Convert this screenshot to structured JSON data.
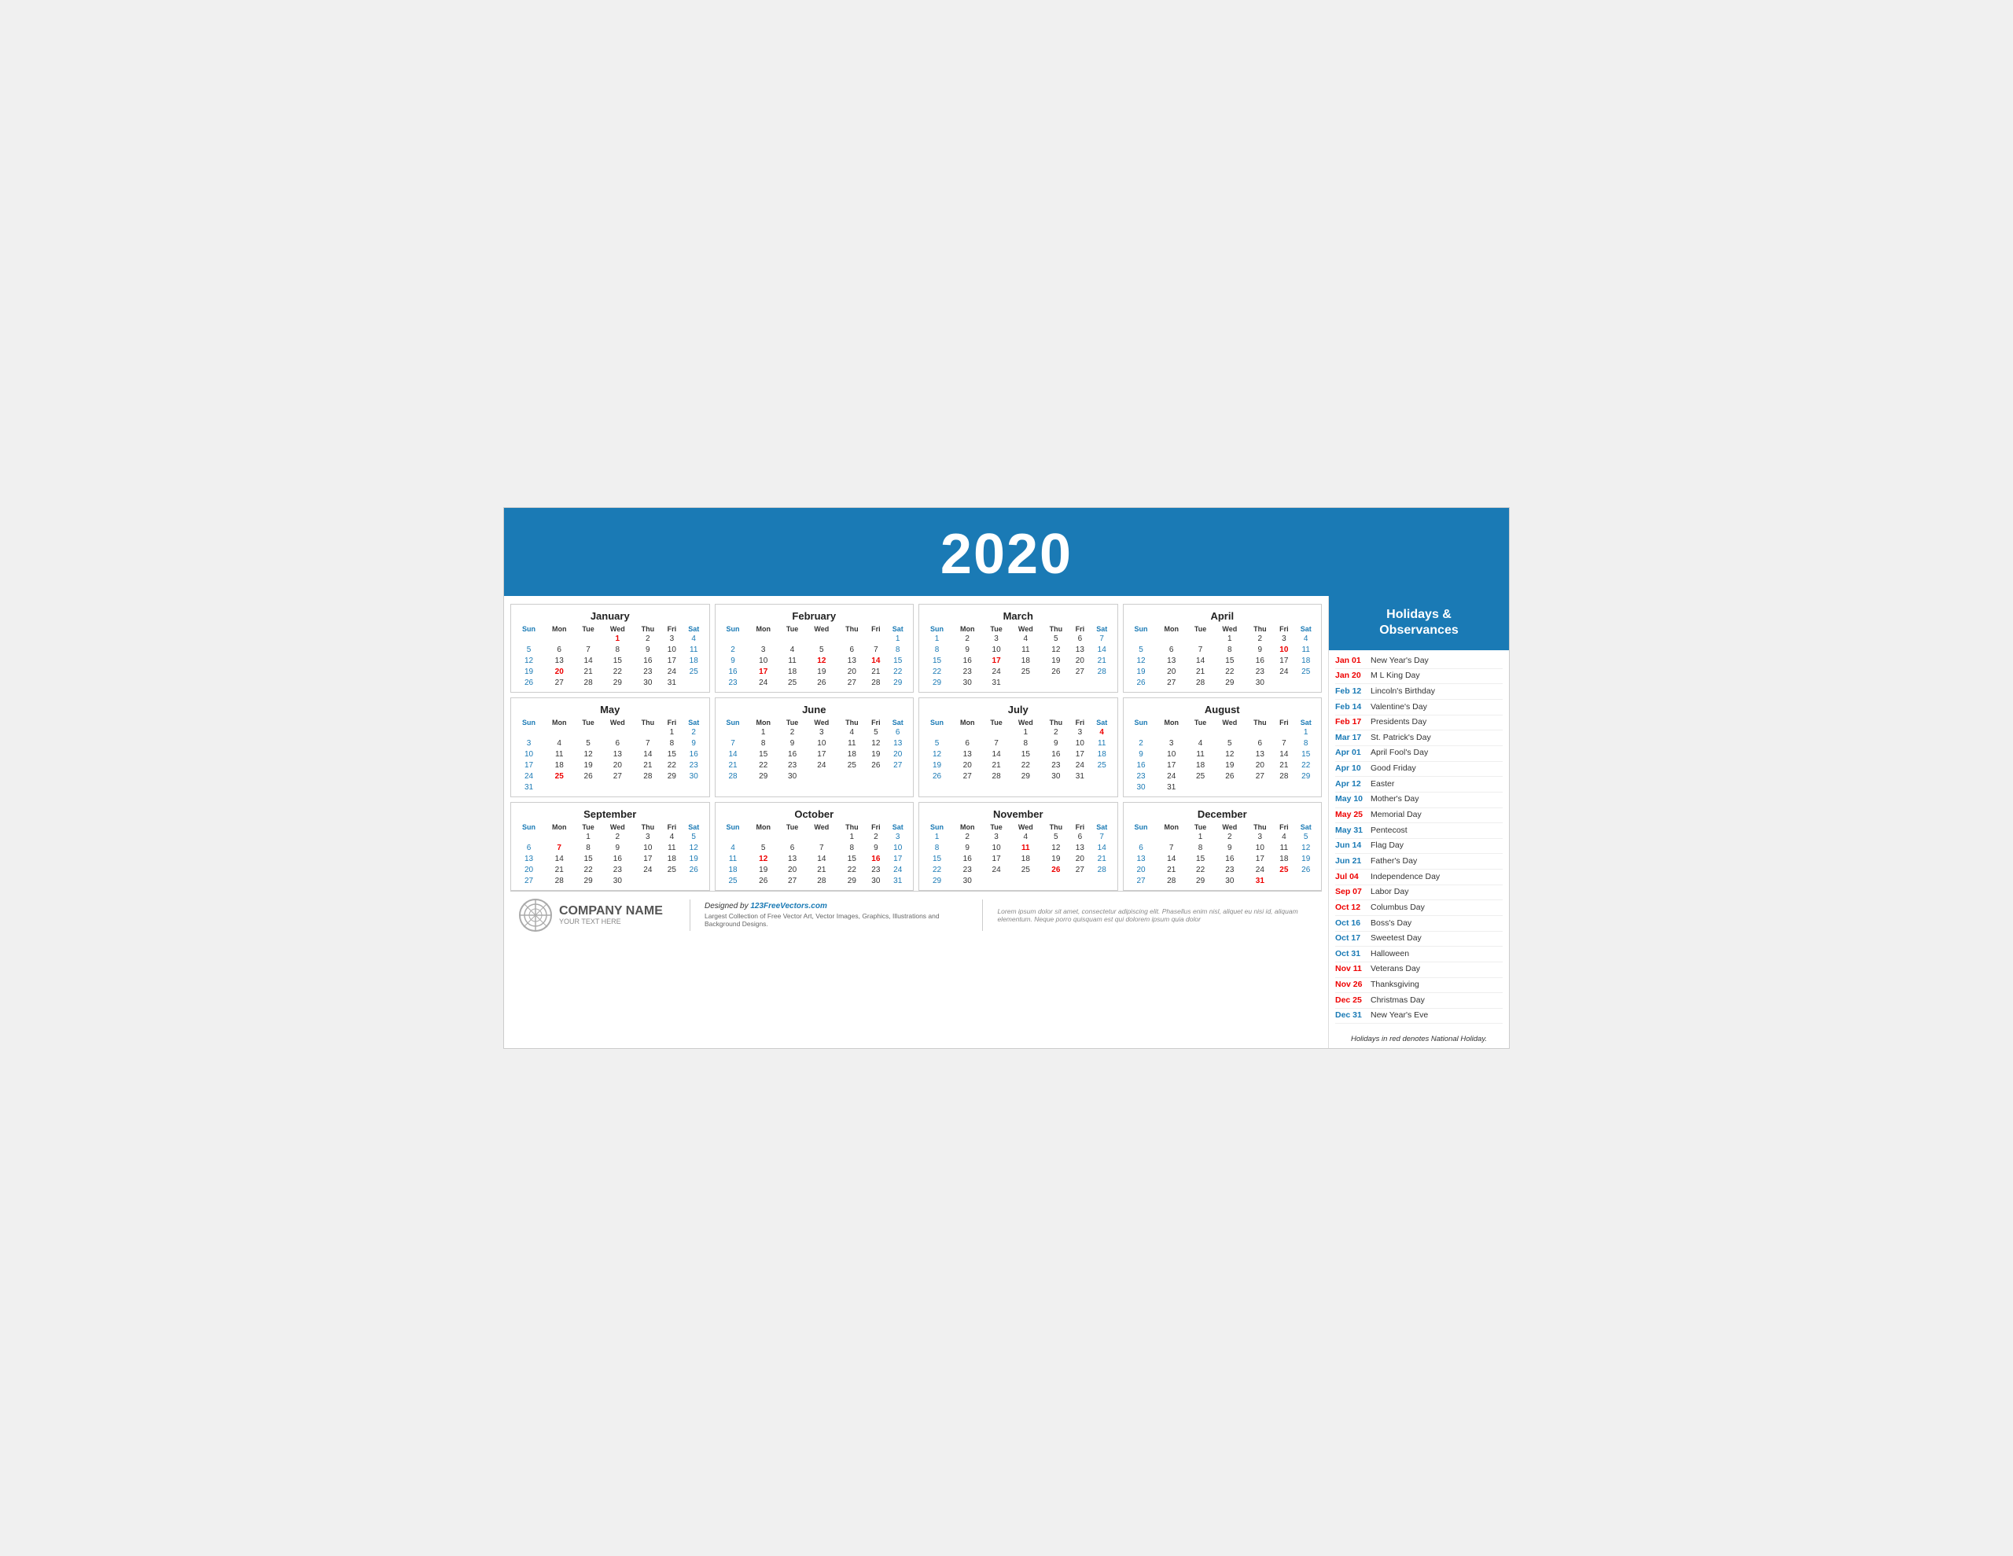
{
  "header": {
    "year": "2020"
  },
  "sidebar_header": "Holidays &\nObservances",
  "holidays": [
    {
      "date": "Jan 01",
      "name": "New Year's Day",
      "type": "red"
    },
    {
      "date": "Jan 20",
      "name": "M L King Day",
      "type": "red"
    },
    {
      "date": "Feb 12",
      "name": "Lincoln's Birthday",
      "type": "blue"
    },
    {
      "date": "Feb 14",
      "name": "Valentine's Day",
      "type": "blue"
    },
    {
      "date": "Feb 17",
      "name": "Presidents Day",
      "type": "red"
    },
    {
      "date": "Mar 17",
      "name": "St. Patrick's Day",
      "type": "blue"
    },
    {
      "date": "Apr 01",
      "name": "April Fool's Day",
      "type": "blue"
    },
    {
      "date": "Apr 10",
      "name": "Good Friday",
      "type": "blue"
    },
    {
      "date": "Apr 12",
      "name": "Easter",
      "type": "blue"
    },
    {
      "date": "May 10",
      "name": "Mother's Day",
      "type": "blue"
    },
    {
      "date": "May 25",
      "name": "Memorial Day",
      "type": "red"
    },
    {
      "date": "May 31",
      "name": "Pentecost",
      "type": "blue"
    },
    {
      "date": "Jun 14",
      "name": "Flag Day",
      "type": "blue"
    },
    {
      "date": "Jun 21",
      "name": "Father's Day",
      "type": "blue"
    },
    {
      "date": "Jul 04",
      "name": "Independence Day",
      "type": "red"
    },
    {
      "date": "Sep 07",
      "name": "Labor Day",
      "type": "red"
    },
    {
      "date": "Oct 12",
      "name": "Columbus Day",
      "type": "red"
    },
    {
      "date": "Oct 16",
      "name": "Boss's Day",
      "type": "blue"
    },
    {
      "date": "Oct 17",
      "name": "Sweetest Day",
      "type": "blue"
    },
    {
      "date": "Oct 31",
      "name": "Halloween",
      "type": "blue"
    },
    {
      "date": "Nov 11",
      "name": "Veterans Day",
      "type": "red"
    },
    {
      "date": "Nov 26",
      "name": "Thanksgiving",
      "type": "red"
    },
    {
      "date": "Dec 25",
      "name": "Christmas Day",
      "type": "red"
    },
    {
      "date": "Dec 31",
      "name": "New Year's Eve",
      "type": "blue"
    }
  ],
  "footer": {
    "company_name": "COMPANY NAME",
    "company_sub": "YOUR TEXT HERE",
    "designed_by": "Designed by 123FreeVectors.com",
    "designed_desc": "Largest Collection of Free Vector Art, Vector Images, Graphics, Illustrations and Background Designs.",
    "lorem": "Lorem ipsum dolor sit amet, consectetur adipiscing elit. Phasellus enim nisl, aliquet eu nisi id, aliquam elementum. Neque porro quisquam est qui dolorem ipsum quia dolor",
    "sidebar_note": "Holidays in red denotes National Holiday."
  }
}
